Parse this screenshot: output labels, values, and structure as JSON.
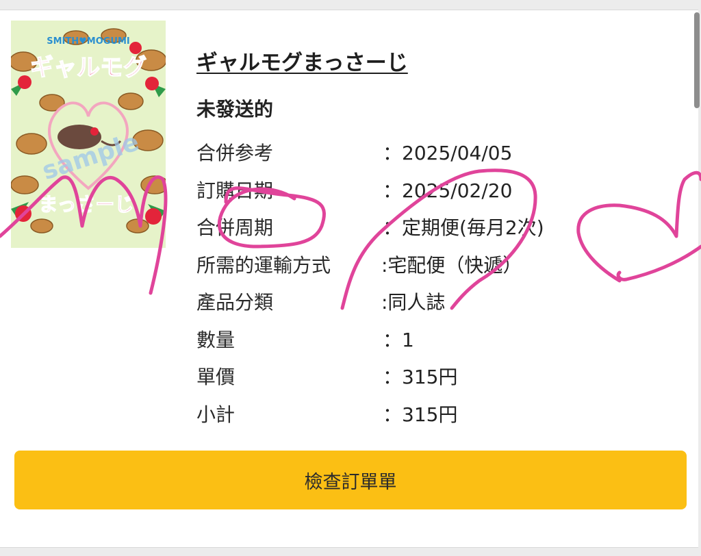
{
  "product": {
    "title": "ギャルモグまっさーじ",
    "status": "未發送的",
    "thumbnail": {
      "author_text": "SMITH♥MOGUMI",
      "title_top": "ギャルモグ",
      "title_bottom": "まっさーじ",
      "watermark": "sample",
      "bg_color": "#e6f3c9",
      "accent": "#e8326b"
    }
  },
  "details": [
    {
      "label": "合併参考",
      "value": "：2025/04/05"
    },
    {
      "label": "訂購日期",
      "value": "：2025/02/20"
    },
    {
      "label": "合併周期",
      "value": "：定期便(毎月2次)"
    },
    {
      "label": "所需的運輸方式",
      "value": ":宅配便（快遞）"
    },
    {
      "label": "產品分類",
      "value": ":同人誌"
    },
    {
      "label": "數量",
      "value": "：1"
    },
    {
      "label": "單價",
      "value": "：315円"
    },
    {
      "label": "小計",
      "value": "：315円"
    }
  ],
  "action": {
    "check_order_label": "檢查訂單單",
    "color": "#fbbf14"
  },
  "overlay": {
    "scribble_color": "#e0449a"
  }
}
